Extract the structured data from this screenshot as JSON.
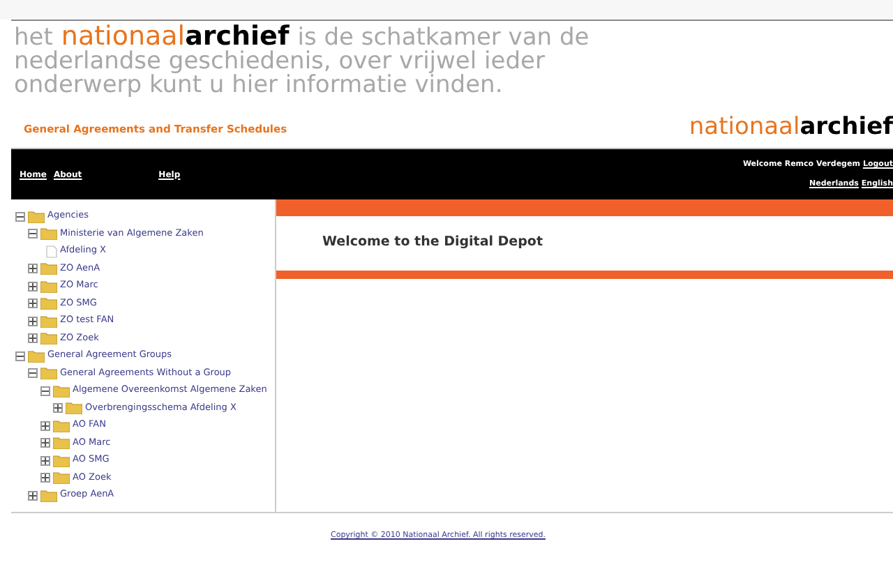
{
  "banner": {
    "lines": [
      [
        "het",
        "is de schatkamer van de"
      ],
      [
        "nederlandse geschiedenis, over vrijwel ieder"
      ],
      [
        "onderwerp kunt u hier informatie vinden."
      ]
    ],
    "logo": {
      "light": "nationaal",
      "bold": "archief"
    }
  },
  "header": {
    "title": "General Agreements and Transfer Schedules",
    "logo": {
      "light": "nationaal",
      "bold": "archief"
    }
  },
  "nav": {
    "links": [
      "Home",
      "About",
      "Help"
    ],
    "welcome": "Welcome Remco Verdegem",
    "logout": "Logout",
    "languages": [
      "Nederlands",
      "English"
    ]
  },
  "tree": [
    {
      "label": "Agencies",
      "kind": "folder",
      "expanded": true,
      "children": [
        {
          "label": "Ministerie van Algemene Zaken",
          "kind": "folder",
          "expanded": true,
          "children": [
            {
              "label": "Afdeling X",
              "kind": "document"
            }
          ]
        },
        {
          "label": "ZO AenA",
          "kind": "folder",
          "expanded": false
        },
        {
          "label": "ZO Marc",
          "kind": "folder",
          "expanded": false
        },
        {
          "label": "ZO SMG",
          "kind": "folder",
          "expanded": false
        },
        {
          "label": "ZO test FAN",
          "kind": "folder",
          "expanded": false
        },
        {
          "label": "ZO Zoek",
          "kind": "folder",
          "expanded": false
        }
      ]
    },
    {
      "label": "General Agreement Groups",
      "kind": "folder",
      "expanded": true,
      "children": [
        {
          "label": "General Agreements Without a Group",
          "kind": "folder",
          "expanded": true,
          "children": [
            {
              "label": "Algemene Overeenkomst Algemene Zaken",
              "kind": "folder",
              "expanded": true,
              "children": [
                {
                  "label": "Overbrengingsschema Afdeling X",
                  "kind": "folder",
                  "expanded": false
                }
              ]
            },
            {
              "label": "AO FAN",
              "kind": "folder",
              "expanded": false
            },
            {
              "label": "AO Marc",
              "kind": "folder",
              "expanded": false
            },
            {
              "label": "AO SMG",
              "kind": "folder",
              "expanded": false
            },
            {
              "label": "AO Zoek",
              "kind": "folder",
              "expanded": false
            }
          ]
        },
        {
          "label": "Groep AenA",
          "kind": "folder",
          "expanded": false
        }
      ]
    }
  ],
  "main": {
    "heading": "Welcome to the Digital Depot"
  },
  "footer": {
    "copyright": "Copyright © 2010 Nationaal Archief. All rights reserved."
  }
}
